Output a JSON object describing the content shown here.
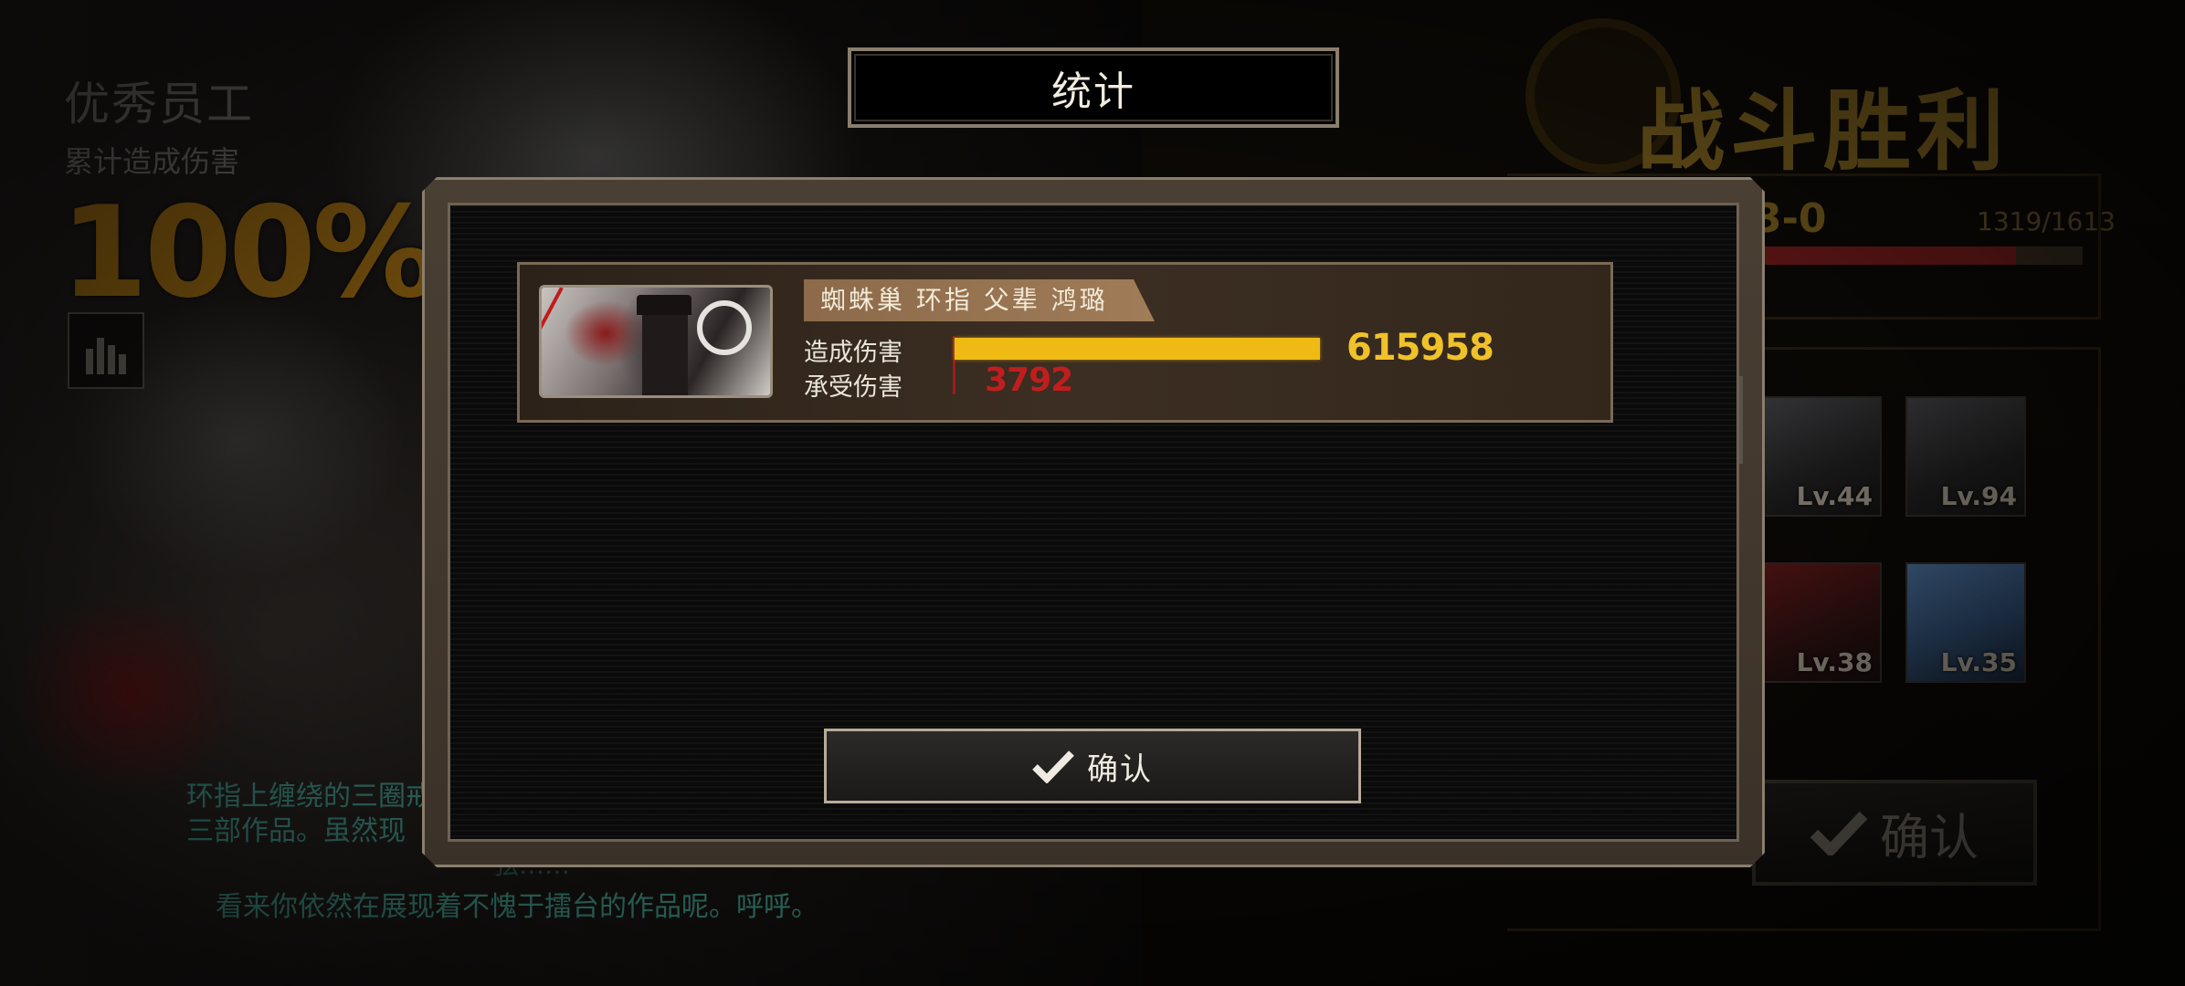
{
  "background": {
    "mvp_title": "优秀员工",
    "mvp_subtitle": "累计造成伤害",
    "mvp_percent": "100%",
    "dialogue_line1": "环指上缠绕的三圈戒的三部作品。虽然现",
    "dialogue_speaker": "弦……",
    "dialogue_line2": "看来你依然在展现着不愧于擂台的作品呢。呼呼。",
    "victory_title": "战斗胜利",
    "stage_label": "3-0",
    "exp_text": "1319/1613",
    "exp_fraction": 0.818,
    "characters": [
      {
        "level": "Lv.44"
      },
      {
        "level": "Lv.94"
      },
      {
        "level": "Lv.38"
      },
      {
        "level": "Lv.35"
      }
    ],
    "confirm_label": "确认"
  },
  "modal": {
    "title": "统计",
    "row": {
      "name": "蜘蛛巢 环指 父辈 鸿璐",
      "damage_dealt_label": "造成伤害",
      "damage_taken_label": "承受伤害",
      "damage_dealt": "615958",
      "damage_taken": "3792"
    },
    "confirm_label": "确认"
  },
  "colors": {
    "dealt_bar": "#f0ba14",
    "taken_value": "#c01e1e",
    "accent_gold": "#b08a2c",
    "dialogue_teal": "#56c7b4"
  }
}
